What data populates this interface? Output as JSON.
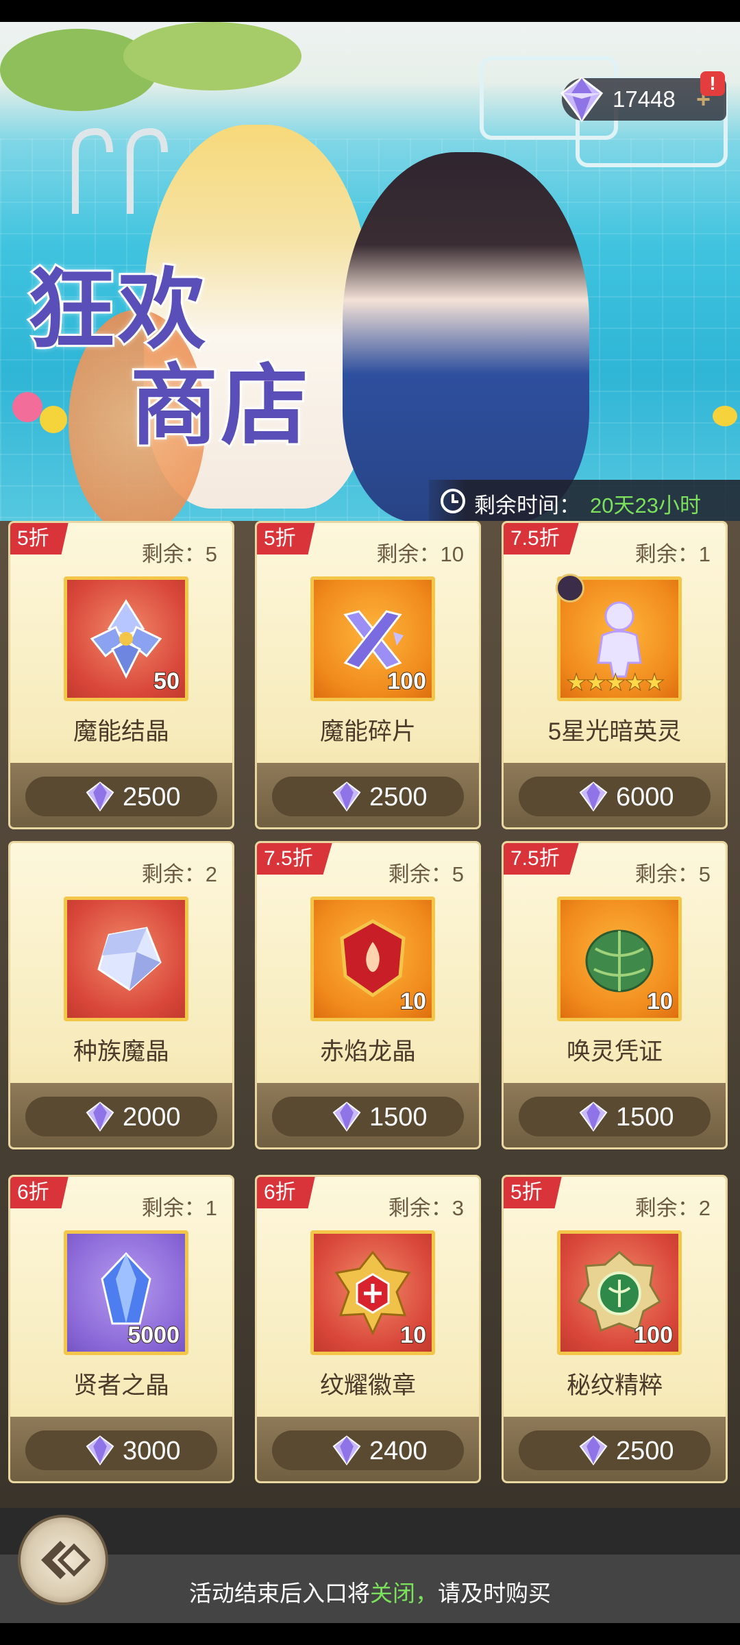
{
  "banner": {
    "title_line1": "狂欢",
    "title_line2": "商店",
    "currency_value": "17448",
    "currency_plus": "+",
    "alert": "!",
    "timer_label": "剩余时间：",
    "timer_value": "20天23小时"
  },
  "colors": {
    "discount_tag": "#d9343a",
    "highlight_green": "#7be05b",
    "title_purple": "#5a4fb8"
  },
  "items": [
    {
      "discount": "5折",
      "remain": "剩余：5",
      "name": "魔能结晶",
      "qty": "50",
      "price": "2500",
      "icon": "crystal-cluster-icon"
    },
    {
      "discount": "5折",
      "remain": "剩余：10",
      "name": "魔能碎片",
      "qty": "100",
      "price": "2500",
      "icon": "crystal-shard-icon"
    },
    {
      "discount": "7.5折",
      "remain": "剩余：1",
      "name": "5星光暗英灵",
      "qty": "",
      "stars": "★★★★★",
      "price": "6000",
      "icon": "hero-silhouette-icon"
    },
    {
      "discount": "",
      "remain": "剩余：2",
      "name": "种族魔晶",
      "qty": "",
      "price": "2000",
      "icon": "ice-cube-icon"
    },
    {
      "discount": "7.5折",
      "remain": "剩余：5",
      "name": "赤焰龙晶",
      "qty": "10",
      "price": "1500",
      "icon": "flame-crest-icon"
    },
    {
      "discount": "7.5折",
      "remain": "剩余：5",
      "name": "唤灵凭证",
      "qty": "10",
      "price": "1500",
      "icon": "leaf-bundle-icon"
    },
    {
      "discount": "6折",
      "remain": "剩余：1",
      "name": "贤者之晶",
      "qty": "5000",
      "price": "3000",
      "icon": "blue-crystal-icon"
    },
    {
      "discount": "6折",
      "remain": "剩余：3",
      "name": "纹耀徽章",
      "qty": "10",
      "price": "2400",
      "icon": "gold-emblem-icon"
    },
    {
      "discount": "5折",
      "remain": "剩余：2",
      "name": "秘纹精粹",
      "qty": "100",
      "price": "2500",
      "icon": "green-emblem-icon"
    }
  ],
  "footer": {
    "notice_pre": "活动结束后入口将",
    "notice_highlight": "关闭，",
    "notice_post": "请及时购买"
  }
}
